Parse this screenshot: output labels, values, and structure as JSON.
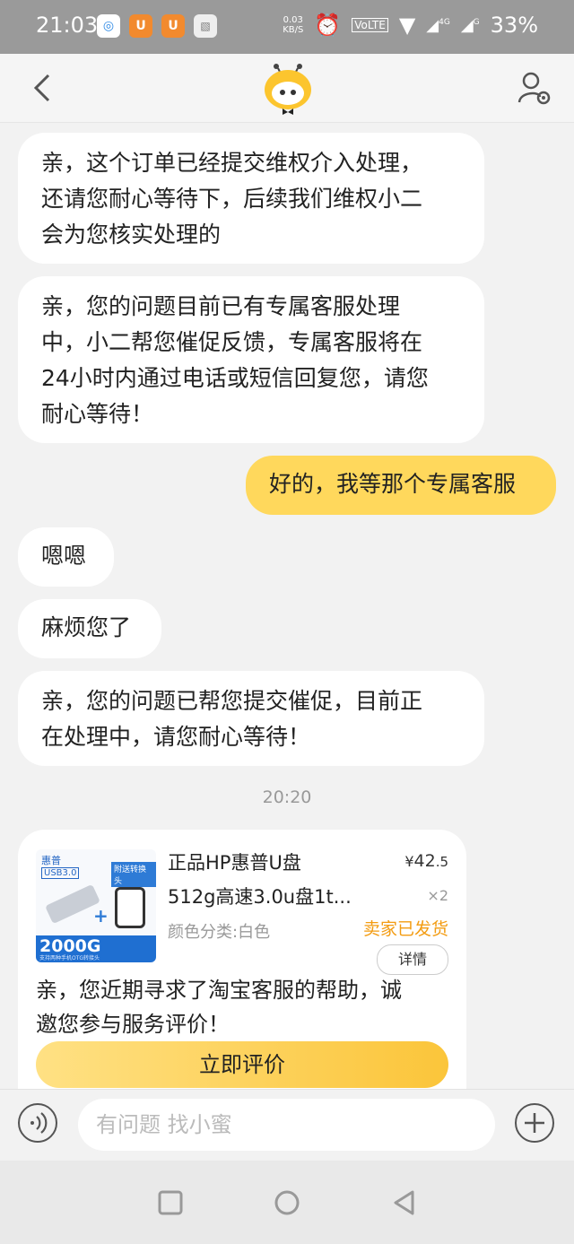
{
  "status_bar": {
    "time": "21:03",
    "speed_value": "0.03",
    "speed_unit": "KB/S",
    "volte": "VoLTE",
    "net_4g": "4G",
    "net_g": "G",
    "battery": "33%"
  },
  "header": {
    "back_icon": "chevron-left-icon",
    "logo_icon": "xiaomi-mascot-icon",
    "profile_icon": "user-settings-icon"
  },
  "messages": [
    {
      "sender": "agent",
      "text": "亲，这个订单已经提交维权介入处理，\n还请您耐心等待下，后续我们维权小二\n会为您核实处理的"
    },
    {
      "sender": "agent",
      "text": "亲，您的问题目前已有专属客服处理\n中，小二帮您催促反馈，专属客服将在\n24小时内通过电话或短信回复您，请您\n耐心等待！"
    },
    {
      "sender": "user",
      "text": "好的，我等那个专属客服"
    },
    {
      "sender": "agent",
      "text": "嗯嗯"
    },
    {
      "sender": "agent",
      "text": "麻烦您了"
    },
    {
      "sender": "agent",
      "text": "亲，您的问题已帮您提交催促，目前正\n在处理中，请您耐心等待！"
    }
  ],
  "timestamp": "20:20",
  "order_card": {
    "thumb": {
      "brand": "惠普",
      "usb": "USB3.0",
      "tag": "附送转换头",
      "capacity": "2000G",
      "subcap": "支持两种手机OTG转接头"
    },
    "product_title": "正品HP惠普U盘\n512g高速3.0u盘1t...",
    "price_yen": "¥",
    "price_int": "42",
    "price_dec": ".5",
    "quantity": "×2",
    "sku": "颜色分类:白色",
    "status": "卖家已发货",
    "detail_button": "详情",
    "message": "亲，您近期寻求了淘宝客服的帮助，诚\n邀您参与服务评价！",
    "rate_button": "立即评价"
  },
  "input_bar": {
    "voice_icon": "voice-icon",
    "placeholder": "有问题 找小蜜",
    "add_icon": "plus-icon"
  },
  "system_nav": {
    "recent_icon": "square-icon",
    "home_icon": "circle-icon",
    "back_icon": "triangle-back-icon"
  }
}
